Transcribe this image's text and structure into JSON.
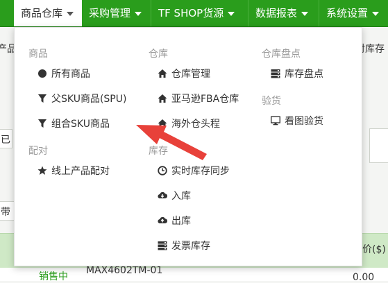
{
  "navbar": {
    "items": [
      {
        "label": "商品仓库",
        "active": true
      },
      {
        "label": "采购管理",
        "active": false
      },
      {
        "label": "TF SHOP货源",
        "active": false
      },
      {
        "label": "数据报表",
        "active": false
      },
      {
        "label": "系统设置",
        "active": false
      }
    ]
  },
  "background": {
    "left_fragment_1": "产品",
    "right_fragment_1": "时库存",
    "left_fragment_2": "已",
    "left_fragment_3": "带",
    "right_price_header": "价($)",
    "row_status": "销售中",
    "row_sku": "MAX4602TM-01",
    "row_value": "0.00"
  },
  "dropdown": {
    "groups": {
      "goods": {
        "heading": "商品",
        "items": [
          "所有商品",
          "父SKU商品(SPU)",
          "组合SKU商品"
        ]
      },
      "match": {
        "heading": "配对",
        "items": [
          "线上产品配对"
        ]
      },
      "warehouse": {
        "heading": "仓库",
        "items": [
          "仓库管理",
          "亚马逊FBA仓库",
          "海外仓头程"
        ]
      },
      "stock": {
        "heading": "库存",
        "items": [
          "实时库存同步",
          "入库",
          "出库",
          "发票库存"
        ]
      },
      "check": {
        "heading": "仓库盘点",
        "items": [
          "库存盘点"
        ]
      },
      "inspect": {
        "heading": "验货",
        "items": [
          "看图验货"
        ]
      }
    }
  },
  "icons": {
    "all_goods": "circle-icon",
    "spu": "filter-icon",
    "combo": "filter-icon",
    "match": "star-icon",
    "warehouse": "home-icon",
    "stock_sync": "clock-icon",
    "stock_in": "cloud-download-icon",
    "stock_out": "cloud-upload-icon",
    "invoice": "server-icon",
    "check": "server-icon",
    "inspect": "monitor-icon"
  },
  "colors": {
    "navbar": "#2a9d1c",
    "arrow": "#e8413a",
    "group_heading": "#999999"
  }
}
